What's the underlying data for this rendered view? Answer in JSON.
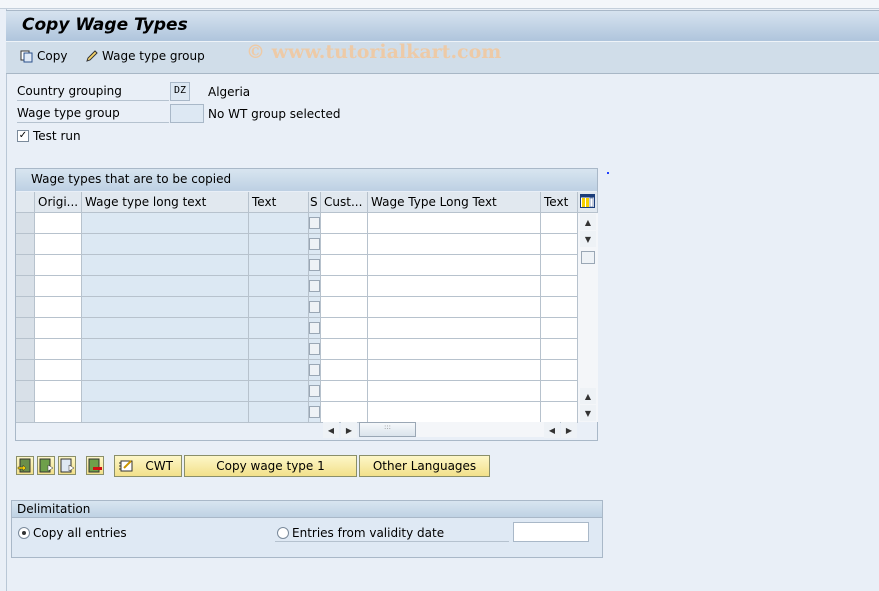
{
  "window": {
    "title": "Copy Wage Types",
    "watermark": "© www.tutorialkart.com"
  },
  "toolbar": {
    "copy_label": "Copy",
    "wage_type_group_label": "Wage type group"
  },
  "form": {
    "country_grouping": {
      "label": "Country grouping",
      "value": "DZ",
      "description": "Algeria"
    },
    "wage_type_group": {
      "label": "Wage type group",
      "value": "",
      "description": "No WT group selected"
    },
    "test_run": {
      "label": "Test run",
      "checked": true
    }
  },
  "table": {
    "title": "Wage types that are to be copied",
    "columns": [
      "Origi...",
      "Wage type long text",
      "Text",
      "S",
      "Cust...",
      "Wage Type Long Text",
      "Text"
    ],
    "row_count": 10,
    "rows": []
  },
  "buttons": {
    "cwt": "CWT",
    "copy_wage_type": "Copy wage type 1",
    "other_languages": "Other Languages"
  },
  "delimitation": {
    "title": "Delimitation",
    "copy_all": {
      "label": "Copy all entries",
      "selected": true
    },
    "validity": {
      "label": "Entries from validity date",
      "selected": false,
      "value": ""
    }
  }
}
